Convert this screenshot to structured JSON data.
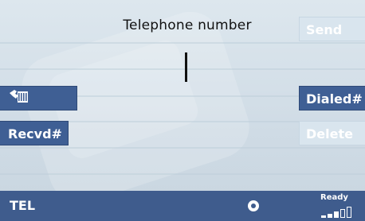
{
  "title": "Telephone number",
  "buttons": {
    "send": "Send",
    "dialed": "Dialed#",
    "received": "Recvd#",
    "delete": "Delete"
  },
  "icons": {
    "phonebook": "phonebook-icon"
  },
  "status": {
    "label": "TEL",
    "ready": "Ready",
    "signal_bars_filled": 3,
    "signal_bars_total": 5
  }
}
